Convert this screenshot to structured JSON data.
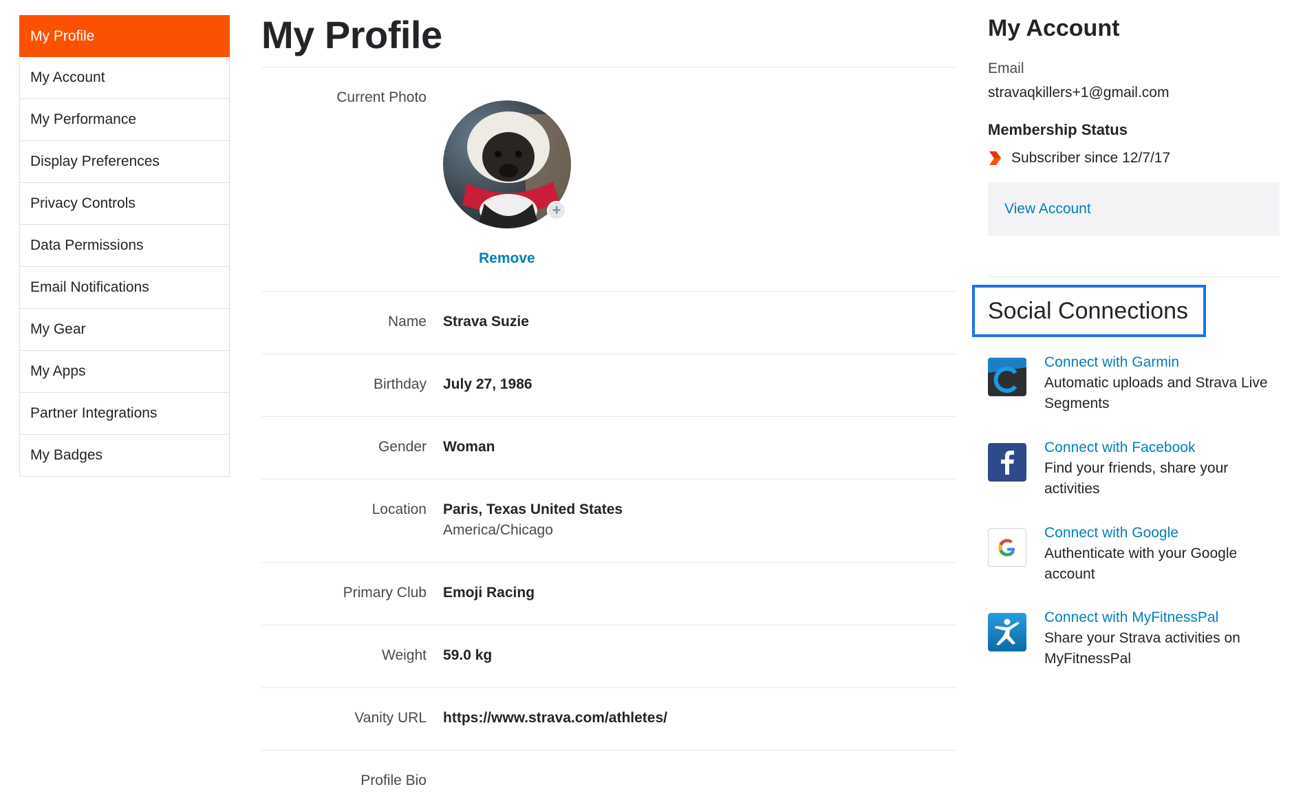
{
  "sidebar": {
    "items": [
      {
        "label": "My Profile",
        "active": true
      },
      {
        "label": "My Account"
      },
      {
        "label": "My Performance"
      },
      {
        "label": "Display Preferences"
      },
      {
        "label": "Privacy Controls"
      },
      {
        "label": "Data Permissions"
      },
      {
        "label": "Email Notifications"
      },
      {
        "label": "My Gear"
      },
      {
        "label": "My Apps"
      },
      {
        "label": "Partner Integrations"
      },
      {
        "label": "My Badges"
      }
    ]
  },
  "main": {
    "title": "My Profile",
    "photo": {
      "label": "Current Photo",
      "remove_label": "Remove"
    },
    "fields": {
      "name": {
        "label": "Name",
        "value": "Strava Suzie"
      },
      "birthday": {
        "label": "Birthday",
        "value": "July 27, 1986"
      },
      "gender": {
        "label": "Gender",
        "value": "Woman"
      },
      "location": {
        "label": "Location",
        "value": "Paris, Texas United States",
        "sub": "America/Chicago"
      },
      "club": {
        "label": "Primary Club",
        "value": "Emoji Racing"
      },
      "weight": {
        "label": "Weight",
        "value": "59.0 kg"
      },
      "vanity": {
        "label": "Vanity URL",
        "value": "https://www.strava.com/athletes/"
      },
      "bio": {
        "label": "Profile Bio"
      }
    }
  },
  "account": {
    "title": "My Account",
    "email_label": "Email",
    "email": "stravaqkillers+1@gmail.com",
    "membership_title": "Membership Status",
    "subscriber_text": "Subscriber since 12/7/17",
    "view_label": "View Account"
  },
  "social": {
    "title": "Social Connections",
    "connections": [
      {
        "link": "Connect with Garmin",
        "desc": "Automatic uploads and Strava Live Segments",
        "icon": "garmin-icon"
      },
      {
        "link": "Connect with Facebook",
        "desc": "Find your friends, share your activities",
        "icon": "facebook-icon"
      },
      {
        "link": "Connect with Google",
        "desc": "Authenticate with your Google account",
        "icon": "google-icon"
      },
      {
        "link": "Connect with MyFitnessPal",
        "desc": "Share your Strava activities on MyFitnessPal",
        "icon": "myfitnesspal-icon"
      }
    ]
  },
  "colors": {
    "accent": "#fc5200",
    "link": "#007fb6",
    "highlight": "#1a73e8"
  }
}
